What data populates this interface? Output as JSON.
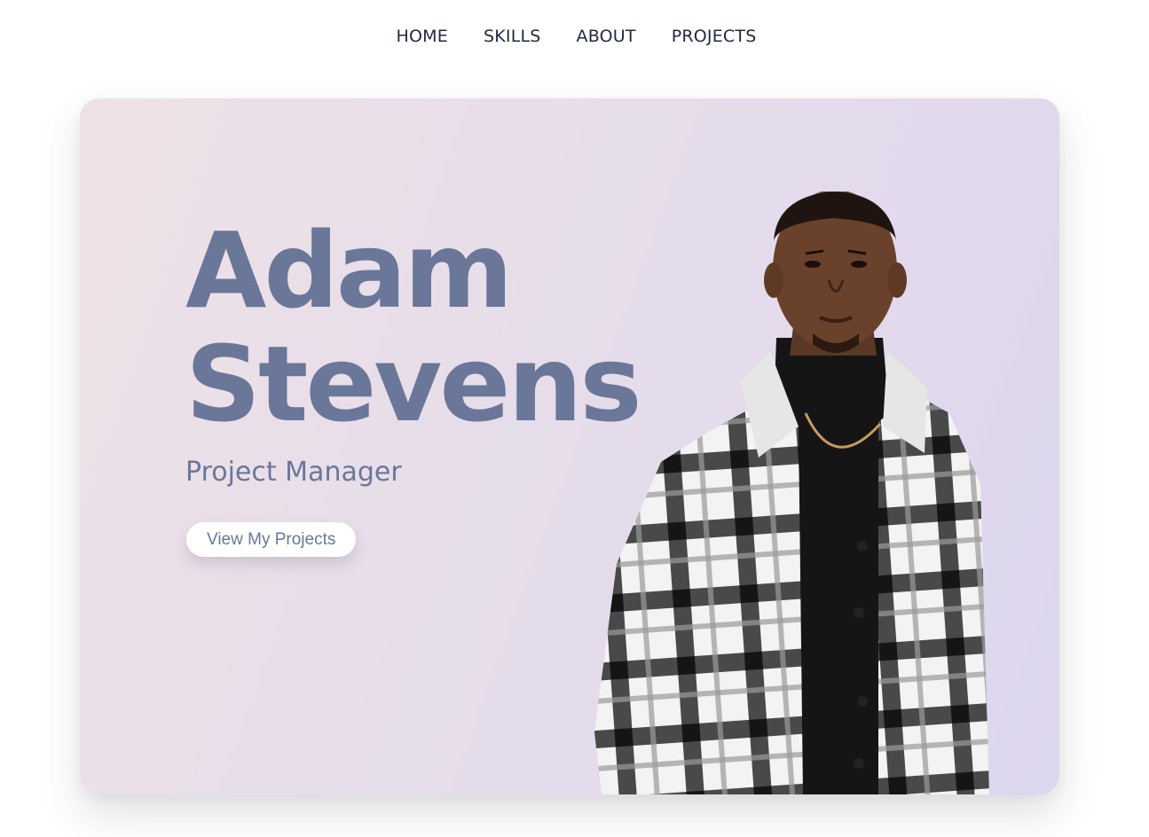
{
  "nav": {
    "items": [
      {
        "label": "HOME"
      },
      {
        "label": "SKILLS"
      },
      {
        "label": "ABOUT"
      },
      {
        "label": "PROJECTS"
      }
    ]
  },
  "hero": {
    "first_name": "Adam",
    "last_name": "Stevens",
    "role": "Project Manager",
    "cta_label": "View My Projects"
  },
  "colors": {
    "accent": "#6a7799",
    "nav_text": "#232842",
    "card_gradient_start": "#efe2e7",
    "card_gradient_end": "#dcd6ee",
    "button_bg": "#ffffff"
  },
  "image": {
    "portrait": "photo of a man in a black turtleneck and black-and-white plaid overshirt"
  }
}
